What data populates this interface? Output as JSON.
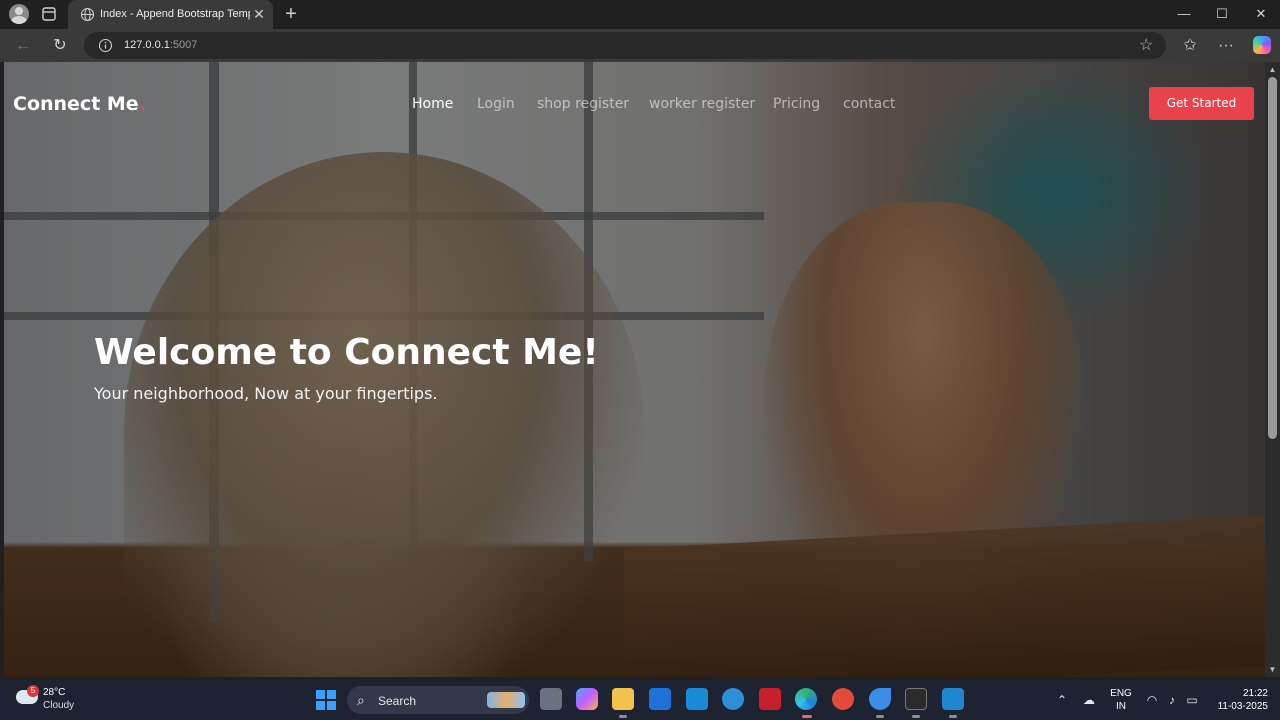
{
  "browser": {
    "tab_title": "Index - Append Bootstrap Template",
    "url_host": "127.0.0.1",
    "url_port": ":5007",
    "new_tab_glyph": "+",
    "close_glyph": "✕",
    "window_controls": {
      "minimize": "—",
      "maximize": "☐",
      "close": "✕"
    },
    "toolbar_icons": [
      "back-icon",
      "reload-icon",
      "info-icon",
      "star-icon",
      "favorites-icon",
      "more-icon",
      "copilot-icon"
    ]
  },
  "site": {
    "brand": "Connect Me",
    "brand_dot": ".",
    "nav": [
      {
        "label": "Home",
        "active": true
      },
      {
        "label": "Login",
        "active": false
      },
      {
        "label": "shop register",
        "active": false
      },
      {
        "label": "worker register",
        "active": false
      },
      {
        "label": "Pricing",
        "active": false
      },
      {
        "label": "contact",
        "active": false
      }
    ],
    "cta_label": "Get Started",
    "hero": {
      "title": "Welcome to Connect Me!",
      "subtitle": "Your neighborhood, Now at your fingertips."
    }
  },
  "taskbar": {
    "weather": {
      "badge": "5",
      "temp": "28°C",
      "condition": "Cloudy"
    },
    "search_label": "Search",
    "language": {
      "line1": "ENG",
      "line2": "IN"
    },
    "clock": {
      "time": "21:22",
      "date": "11-03-2025"
    }
  },
  "colors": {
    "accent": "#e9424a",
    "brand_dot": "#e74c4c",
    "taskbar": "#1d2330"
  }
}
